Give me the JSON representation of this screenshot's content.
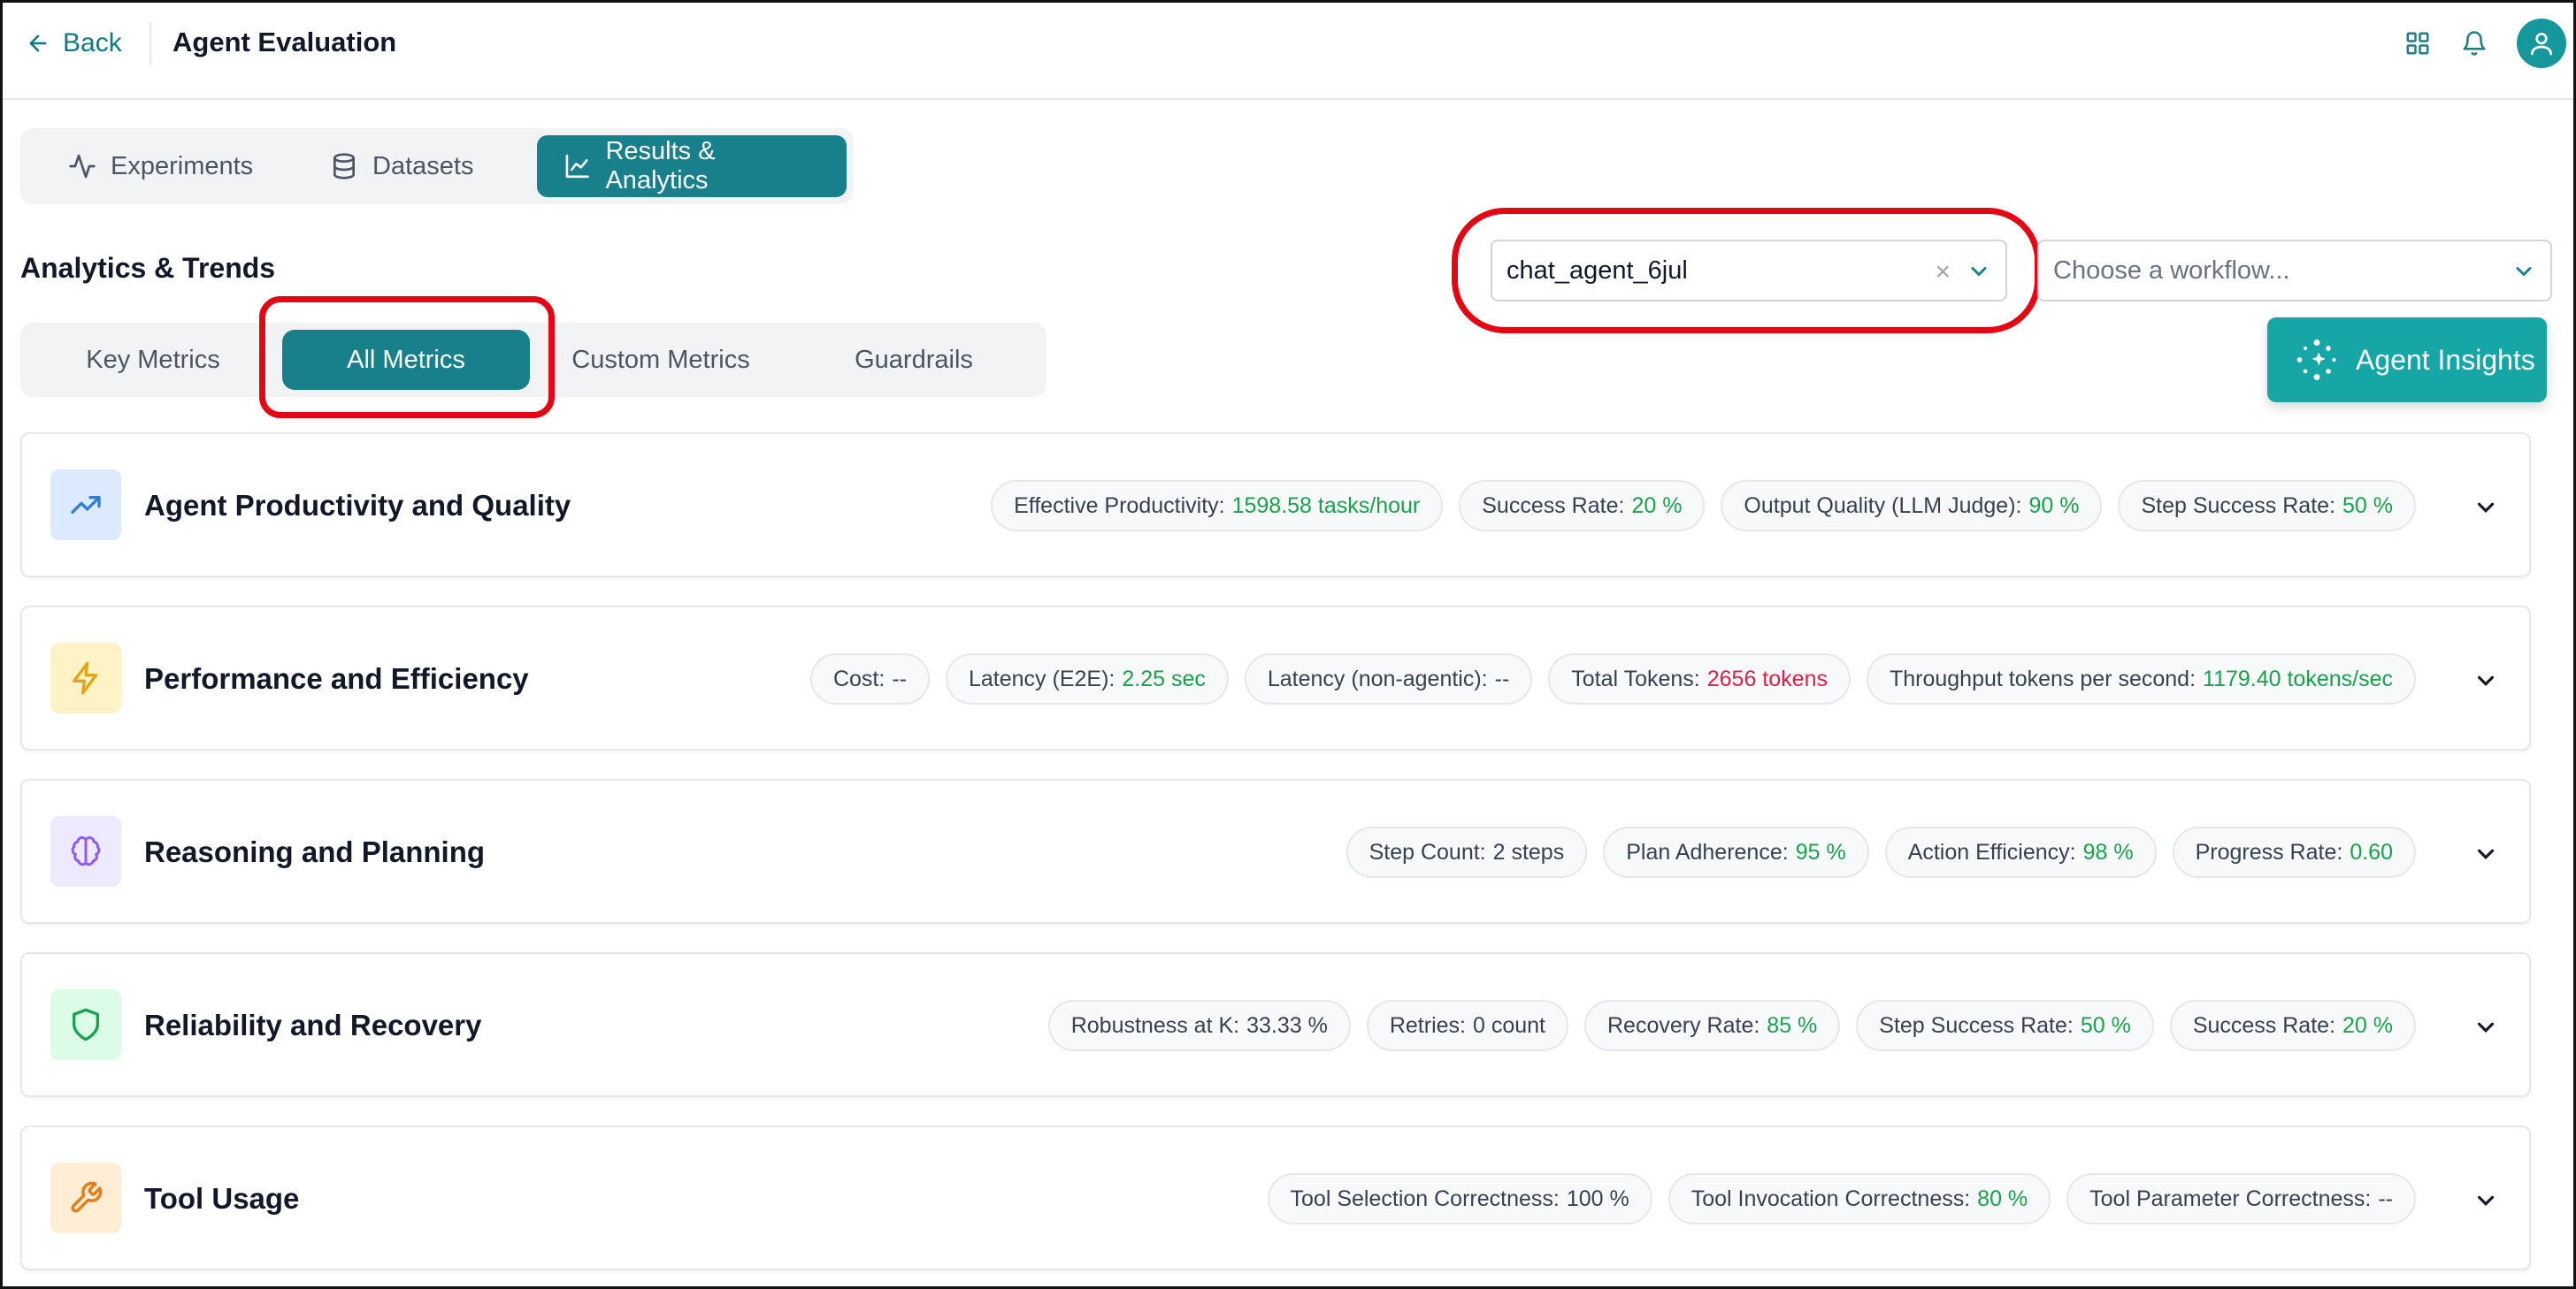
{
  "header": {
    "back_label": "Back",
    "title": "Agent Evaluation",
    "icons": [
      "grid-icon",
      "bell-icon",
      "user-avatar-icon"
    ]
  },
  "top_tabs": [
    {
      "label": "Experiments",
      "icon": "activity-icon",
      "active": false
    },
    {
      "label": "Datasets",
      "icon": "database-icon",
      "active": false
    },
    {
      "label": "Results & Analytics",
      "icon": "chart-line-icon",
      "active": true
    }
  ],
  "analytics": {
    "title": "Analytics & Trends",
    "agent_select": {
      "value": "chat_agent_6jul"
    },
    "workflow_select": {
      "placeholder": "Choose a workflow..."
    },
    "insights_label": "Agent Insights"
  },
  "sub_tabs": [
    {
      "label": "Key Metrics",
      "active": false
    },
    {
      "label": "All Metrics",
      "active": true
    },
    {
      "label": "Custom Metrics",
      "active": false
    },
    {
      "label": "Guardrails",
      "active": false
    }
  ],
  "colors": {
    "accent": "#17808a",
    "good": "#16a34a",
    "bad": "#e11d48",
    "annotation": "#e30613"
  },
  "cards": [
    {
      "title": "Agent Productivity and Quality",
      "icon": "trending-up-icon",
      "chips": [
        {
          "label": "Effective Productivity:",
          "value": "1598.58 tasks/hour",
          "tone": "g"
        },
        {
          "label": "Success Rate:",
          "value": "20 %",
          "tone": "g"
        },
        {
          "label": "Output Quality (LLM Judge):",
          "value": "90 %",
          "tone": "g"
        },
        {
          "label": "Step Success Rate:",
          "value": "50 %",
          "tone": "g"
        }
      ]
    },
    {
      "title": "Performance and Efficiency",
      "icon": "lightning-icon",
      "chips": [
        {
          "label": "Cost:",
          "value": "--",
          "tone": "n"
        },
        {
          "label": "Latency (E2E):",
          "value": "2.25 sec",
          "tone": "g"
        },
        {
          "label": "Latency (non-agentic):",
          "value": "--",
          "tone": "n"
        },
        {
          "label": "Total Tokens:",
          "value": "2656 tokens",
          "tone": "r"
        },
        {
          "label": "Throughput tokens per second:",
          "value": "1179.40 tokens/sec",
          "tone": "g"
        }
      ]
    },
    {
      "title": "Reasoning and Planning",
      "icon": "brain-icon",
      "chips": [
        {
          "label": "Step Count:",
          "value": "2 steps",
          "tone": "n"
        },
        {
          "label": "Plan Adherence:",
          "value": "95 %",
          "tone": "g"
        },
        {
          "label": "Action Efficiency:",
          "value": "98 %",
          "tone": "g"
        },
        {
          "label": "Progress Rate:",
          "value": "0.60",
          "tone": "g"
        }
      ]
    },
    {
      "title": "Reliability and Recovery",
      "icon": "shield-icon",
      "chips": [
        {
          "label": "Robustness at K:",
          "value": "33.33 %",
          "tone": "n"
        },
        {
          "label": "Retries:",
          "value": "0 count",
          "tone": "n"
        },
        {
          "label": "Recovery Rate:",
          "value": "85 %",
          "tone": "g"
        },
        {
          "label": "Step Success Rate:",
          "value": "50 %",
          "tone": "g"
        },
        {
          "label": "Success Rate:",
          "value": "20 %",
          "tone": "g"
        }
      ]
    },
    {
      "title": "Tool Usage",
      "icon": "wrench-icon",
      "chips": [
        {
          "label": "Tool Selection Correctness:",
          "value": "100 %",
          "tone": "n"
        },
        {
          "label": "Tool Invocation Correctness:",
          "value": "80 %",
          "tone": "g"
        },
        {
          "label": "Tool Parameter Correctness:",
          "value": "--",
          "tone": "n"
        }
      ]
    }
  ]
}
